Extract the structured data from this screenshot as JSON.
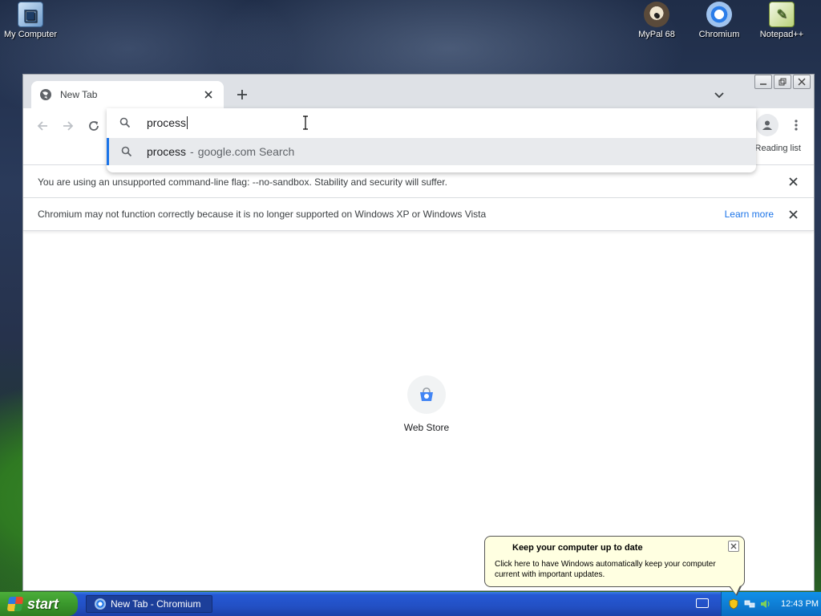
{
  "desktop": {
    "icons": [
      {
        "label": "My Computer"
      },
      {
        "label": "MyPal 68"
      },
      {
        "label": "Chromium"
      },
      {
        "label": "Notepad++"
      }
    ]
  },
  "browser": {
    "tab": {
      "title": "New Tab"
    },
    "omnibox": {
      "typed": "process",
      "suggestion": {
        "main": "process",
        "separator": "-",
        "sub": "google.com Search"
      }
    },
    "toolbar": {
      "reading_list": "Reading list"
    },
    "infobars": {
      "sandbox": "You are using an unsupported command-line flag: --no-sandbox. Stability and security will suffer.",
      "xp": "Chromium may not function correctly because it is no longer supported on Windows XP or Windows Vista",
      "learn_more": "Learn more"
    },
    "shortcut": {
      "label": "Web Store"
    }
  },
  "balloon": {
    "title": "Keep your computer up to date",
    "text": "Click here to have Windows automatically keep your computer current with important updates."
  },
  "taskbar": {
    "start": "start",
    "task": "New Tab - Chromium",
    "clock": "12:43 PM"
  },
  "colors": {
    "accent": "#1a73e8",
    "taskbar": "#2350c4",
    "start_green": "#3a982c",
    "balloon_bg": "#ffffe1"
  }
}
